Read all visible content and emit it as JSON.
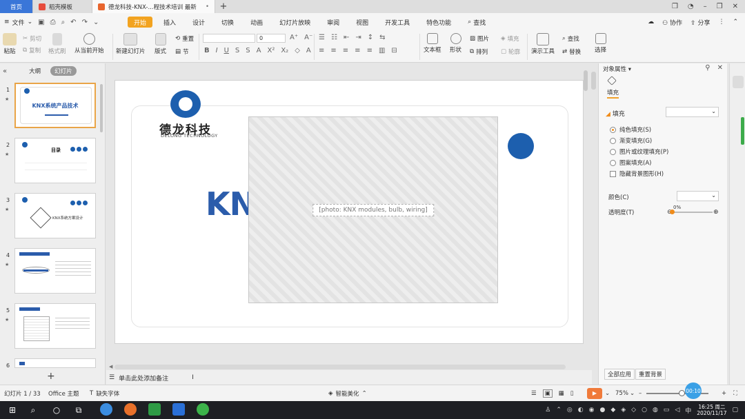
{
  "tabs": {
    "home": "首页",
    "template": "稻壳模板",
    "document": "德龙科技-KNX-...程技术培训 最新"
  },
  "menu": {
    "file": "文件",
    "tabs": [
      "开始",
      "插入",
      "设计",
      "切换",
      "动画",
      "幻灯片放映",
      "审阅",
      "视图",
      "开发工具",
      "特色功能",
      "查找"
    ],
    "right": {
      "collab": "协作",
      "share": "分享"
    }
  },
  "ribbon": {
    "paste": "粘贴",
    "cut": "剪切",
    "copy": "复制",
    "format_painter": "格式刷",
    "play_from_current": "从当前开始",
    "new_slide": "新建幻灯片",
    "layout": "版式",
    "section": "节",
    "reset": "重置",
    "font_size": "0",
    "text_box": "文本框",
    "shape": "形状",
    "arrange": "排列",
    "picture": "图片",
    "fill": "填充",
    "outline": "轮廓",
    "presentation_tool": "演示工具",
    "find": "查找",
    "replace": "替换",
    "select": "选择"
  },
  "left_panel": {
    "view_outline": "大纲",
    "view_slides": "幻灯片",
    "slides": [
      {
        "num": "1",
        "title": "KNX系统产品技术"
      },
      {
        "num": "2",
        "title": "目录"
      },
      {
        "num": "3",
        "title": "KNX系统方案设计"
      },
      {
        "num": "4",
        "title": ""
      },
      {
        "num": "5",
        "title": ""
      },
      {
        "num": "6",
        "title": ""
      }
    ]
  },
  "slide": {
    "brand_cn": "德龙科技",
    "brand_en": "DELONG TECHNOLOGY",
    "title_partial": "KN",
    "photo_label": "[photo: KNX modules, bulb, wiring]",
    "notes_placeholder": "单击此处添加备注"
  },
  "right_panel": {
    "title": "对象属性",
    "tab_fill": "填充",
    "section_fill": "填充",
    "options": [
      "纯色填充(S)",
      "渐变填充(G)",
      "图片或纹理填充(P)",
      "图案填充(A)"
    ],
    "hide_bg": "隐藏背景图形(H)",
    "color_label": "颜色(C)",
    "transparency_label": "透明度(T)",
    "transparency_value": "0%",
    "apply_all": "全部应用",
    "reset_bg": "重置背景"
  },
  "status": {
    "slide_count": "幻灯片 1 / 33",
    "theme": "Office 主题",
    "missing_font": "缺失字体",
    "smart_beautify": "智能美化",
    "zoom": "75%",
    "timer": "00:10"
  },
  "taskbar": {
    "ime": "中",
    "time": "16:25 周二",
    "date": "2020/11/17"
  }
}
